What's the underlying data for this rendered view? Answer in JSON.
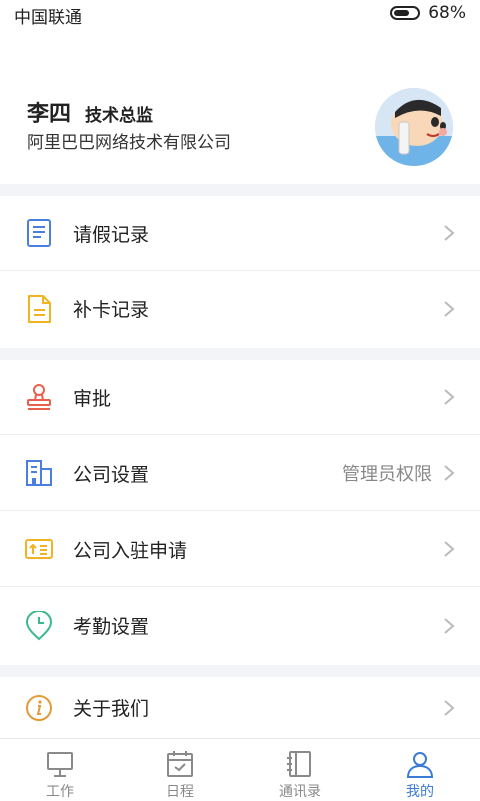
{
  "status": {
    "carrier": "中国联通",
    "battery": "68%",
    "battery_level": 0.68
  },
  "profile": {
    "name": "李四",
    "title": "技术总监",
    "company": "阿里巴巴网络技术有限公司",
    "avatar_icon": "cartoon-avatar"
  },
  "menu": {
    "leave_records": {
      "label": "请假记录",
      "icon": "document-icon"
    },
    "clockin_records": {
      "label": "补卡记录",
      "icon": "file-icon"
    },
    "approval": {
      "label": "审批",
      "icon": "stamp-icon"
    },
    "company_settings": {
      "label": "公司设置",
      "extra": "管理员权限",
      "icon": "building-icon"
    },
    "company_apply": {
      "label": "公司入驻申请",
      "icon": "upload-card-icon"
    },
    "attendance_settings": {
      "label": "考勤设置",
      "icon": "location-clock-icon"
    },
    "about": {
      "label": "关于我们",
      "icon": "info-icon"
    }
  },
  "tabs": [
    {
      "label": "工作",
      "icon": "monitor-icon"
    },
    {
      "label": "日程",
      "icon": "calendar-icon"
    },
    {
      "label": "通讯录",
      "icon": "contacts-icon"
    },
    {
      "label": "我的",
      "icon": "user-icon",
      "active": true
    }
  ],
  "colors": {
    "accent": "#3a7bd5",
    "doc_blue": "#4a7fe0",
    "yellow": "#f2b322",
    "red": "#e8604c",
    "green": "#3bb88e",
    "orange": "#e39a3b"
  }
}
